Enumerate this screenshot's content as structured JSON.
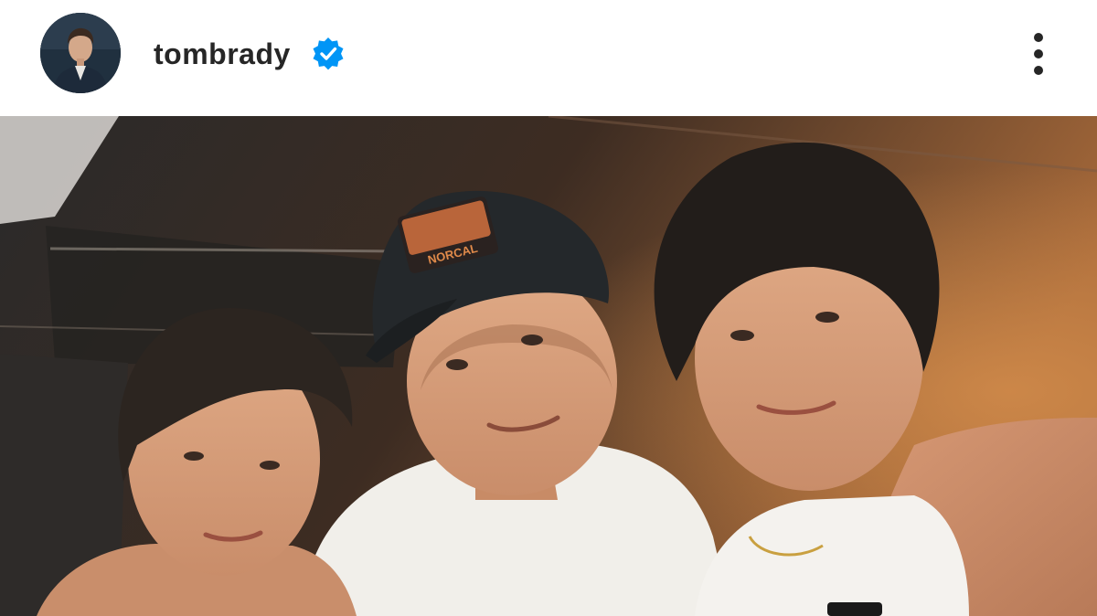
{
  "post": {
    "username": "tombrady",
    "verified": true,
    "avatar_icon": "profile-photo",
    "verified_icon": "verified-badge-icon",
    "more_icon": "more-options-icon",
    "accent_color": "#0095f6",
    "photo": {
      "icon": "post-photo",
      "cap_patch_text": "NORCAL"
    }
  }
}
